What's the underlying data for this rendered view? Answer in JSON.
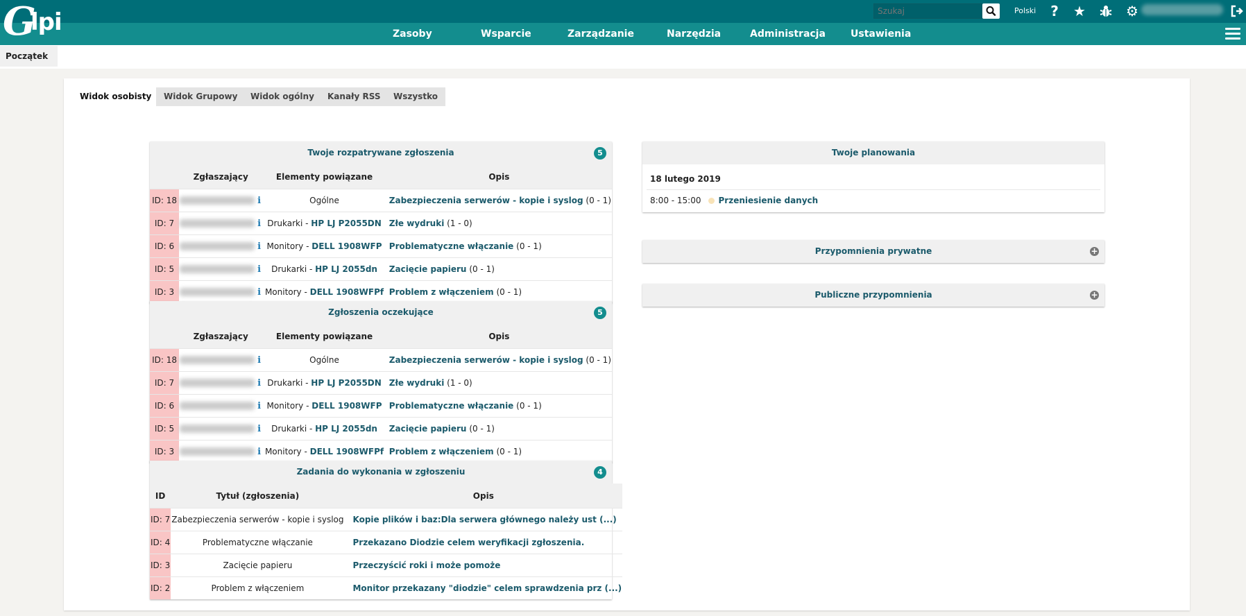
{
  "header": {
    "logo_text": "lpi",
    "logo_g": "G",
    "search_placeholder": "Szukaj",
    "language": "Polski",
    "icons": [
      "help-icon",
      "star-icon",
      "bug-icon",
      "gear-icon",
      "logout-icon"
    ]
  },
  "menu": [
    {
      "label": "Zasoby"
    },
    {
      "label": "Wsparcie"
    },
    {
      "label": "Zarządzanie"
    },
    {
      "label": "Narzędzia"
    },
    {
      "label": "Administracja"
    },
    {
      "label": "Ustawienia"
    }
  ],
  "breadcrumb": {
    "home": "Początek"
  },
  "tabs": [
    {
      "label": "Widok osobisty"
    },
    {
      "label": "Widok Grupowy"
    },
    {
      "label": "Widok ogólny"
    },
    {
      "label": "Kanały RSS"
    },
    {
      "label": "Wszystko"
    }
  ],
  "tickets_in_progress": {
    "title": "Twoje rozpatrywane zgłoszenia",
    "count": "5",
    "columns": {
      "requester": "Zgłaszający",
      "items": "Elementy powiązane",
      "desc": "Opis"
    },
    "rows": [
      {
        "id": "ID: 18",
        "item_type": "Ogólne",
        "item_link": "",
        "title": "Zabezpieczenia serwerów - kopie i syslog",
        "counts": "(0 - 1)"
      },
      {
        "id": "ID: 7",
        "item_type": "Drukarki - ",
        "item_link": "HP LJ P2055DN",
        "title": "Złe wydruki",
        "counts": "(1 - 0)"
      },
      {
        "id": "ID: 6",
        "item_type": "Monitory - ",
        "item_link": "DELL 1908WFP",
        "title": "Problematyczne włączanie",
        "counts": "(0 - 1)"
      },
      {
        "id": "ID: 5",
        "item_type": "Drukarki - ",
        "item_link": "HP LJ 2055dn",
        "title": "Zacięcie papieru",
        "counts": "(0 - 1)"
      },
      {
        "id": "ID: 3",
        "item_type": "Monitory - ",
        "item_link": "DELL 1908WFPf",
        "title": "Problem z włączeniem",
        "counts": "(0 - 1)"
      }
    ]
  },
  "tickets_waiting": {
    "title": "Zgłoszenia oczekujące",
    "count": "5",
    "columns": {
      "requester": "Zgłaszający",
      "items": "Elementy powiązane",
      "desc": "Opis"
    },
    "rows": [
      {
        "id": "ID: 18",
        "item_type": "Ogólne",
        "item_link": "",
        "title": "Zabezpieczenia serwerów - kopie i syslog",
        "counts": "(0 - 1)"
      },
      {
        "id": "ID: 7",
        "item_type": "Drukarki - ",
        "item_link": "HP LJ P2055DN",
        "title": "Złe wydruki",
        "counts": "(1 - 0)"
      },
      {
        "id": "ID: 6",
        "item_type": "Monitory - ",
        "item_link": "DELL 1908WFP",
        "title": "Problematyczne włączanie",
        "counts": "(0 - 1)"
      },
      {
        "id": "ID: 5",
        "item_type": "Drukarki - ",
        "item_link": "HP LJ 2055dn",
        "title": "Zacięcie papieru",
        "counts": "(0 - 1)"
      },
      {
        "id": "ID: 3",
        "item_type": "Monitory - ",
        "item_link": "DELL 1908WFPf",
        "title": "Problem z włączeniem",
        "counts": "(0 - 1)"
      }
    ]
  },
  "tasks": {
    "title": "Zadania do wykonania w zgłoszeniu",
    "count": "4",
    "columns": {
      "id": "ID",
      "ticket_title": "Tytuł (zgłoszenia)",
      "desc": "Opis"
    },
    "rows": [
      {
        "id": "ID: 7",
        "ticket_title": "Zabezpieczenia serwerów - kopie i syslog",
        "desc": "Kopie plików i baz:Dla serwera głównego należy ust (...)"
      },
      {
        "id": "ID: 4",
        "ticket_title": "Problematyczne włączanie",
        "desc": "Przekazano Diodzie celem weryfikacji zgłoszenia."
      },
      {
        "id": "ID: 3",
        "ticket_title": "Zacięcie papieru",
        "desc": "Przeczyścić roki i może pomoże"
      },
      {
        "id": "ID: 2",
        "ticket_title": "Problem z włączeniem",
        "desc": "Monitor przekazany \"diodzie\" celem sprawdzenia prz (...)"
      }
    ]
  },
  "planning": {
    "title": "Twoje planowania",
    "date": "18 lutego 2019",
    "time": "8:00 - 15:00",
    "event": "Przeniesienie danych"
  },
  "reminders_private": {
    "title": "Przypomnienia prywatne"
  },
  "reminders_public": {
    "title": "Publiczne przypomnienia"
  },
  "colors": {
    "topbar": "#006e78",
    "menubar": "#138d8e",
    "link": "#1b5a6b",
    "id_cell": "#f9c5c5"
  }
}
